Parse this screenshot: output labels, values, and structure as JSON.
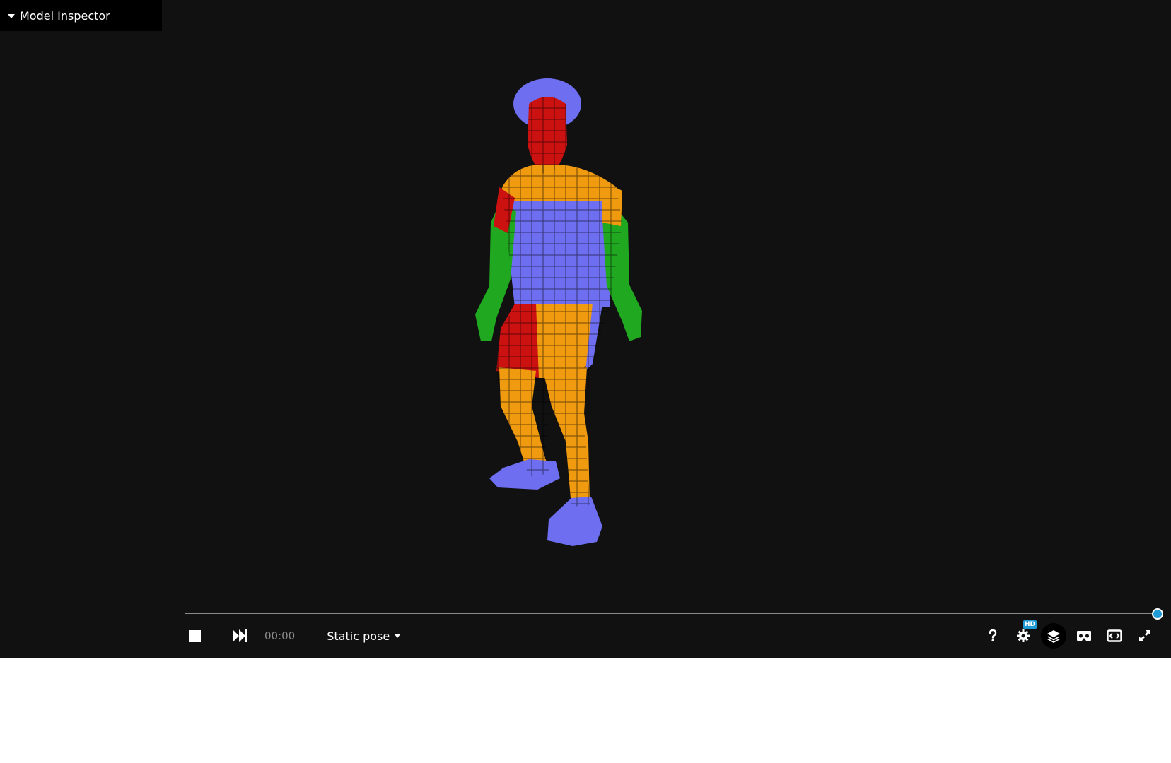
{
  "inspector": {
    "title": "Model Inspector"
  },
  "player": {
    "time": "00:00",
    "animation": "Static pose",
    "progress": 1.0,
    "settings_badge": "HD"
  },
  "colors": {
    "viewer_background": "#111111",
    "accent": "#1e9ad6",
    "model_red": "#cc1111",
    "model_orange": "#f09a10",
    "model_blue": "#6e6ef0",
    "model_green": "#20a820"
  },
  "icons": [
    "stop-icon",
    "skip-forward-icon",
    "help-icon",
    "gear-icon",
    "layers-icon",
    "vr-headset-icon",
    "aspect-ratio-icon",
    "fullscreen-icon"
  ]
}
